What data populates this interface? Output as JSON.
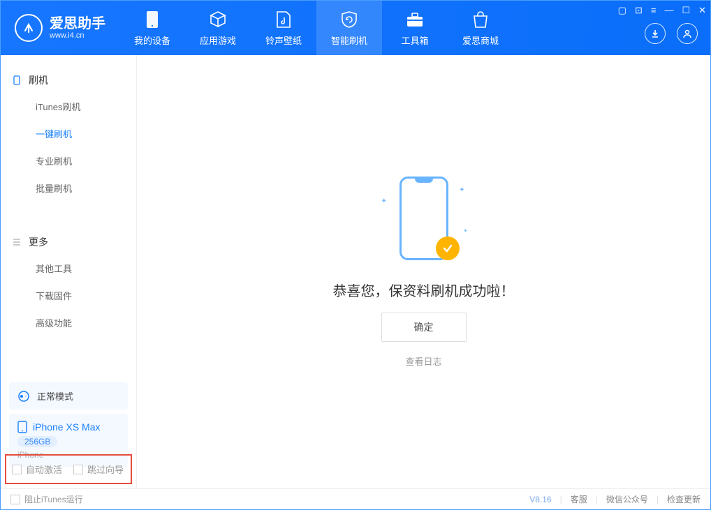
{
  "app": {
    "name": "爱思助手",
    "site": "www.i4.cn"
  },
  "nav": [
    {
      "label": "我的设备"
    },
    {
      "label": "应用游戏"
    },
    {
      "label": "铃声壁纸"
    },
    {
      "label": "智能刷机"
    },
    {
      "label": "工具箱"
    },
    {
      "label": "爱思商城"
    }
  ],
  "sidebar": {
    "group1": {
      "title": "刷机",
      "items": [
        "iTunes刷机",
        "一键刷机",
        "专业刷机",
        "批量刷机"
      ]
    },
    "group2": {
      "title": "更多",
      "items": [
        "其他工具",
        "下载固件",
        "高级功能"
      ]
    }
  },
  "device": {
    "mode": "正常模式",
    "name": "iPhone XS Max",
    "capacity": "256GB",
    "type": "iPhone"
  },
  "checks": {
    "auto_activate": "自动激活",
    "skip_guide": "跳过向导"
  },
  "main": {
    "success_text": "恭喜您，保资料刷机成功啦！",
    "ok": "确定",
    "view_log": "查看日志"
  },
  "footer": {
    "block_itunes": "阻止iTunes运行",
    "version": "V8.16",
    "service": "客服",
    "wechat": "微信公众号",
    "check_update": "检查更新"
  }
}
